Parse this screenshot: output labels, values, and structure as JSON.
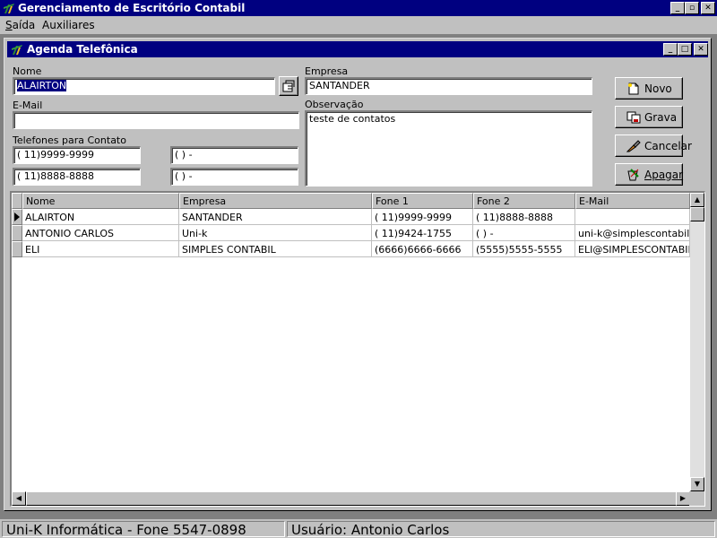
{
  "app": {
    "title": "Gerenciamento de Escritório Contabil",
    "controls": {
      "minimize": "_",
      "restore": "▫",
      "close": "✕"
    }
  },
  "menu": [
    {
      "label": "Saída"
    },
    {
      "label": "Auxiliares"
    }
  ],
  "child": {
    "title": "Agenda Telefônica"
  },
  "form": {
    "nome_label": "Nome",
    "nome_value": "ALAIRTON",
    "empresa_label": "Empresa",
    "empresa_value": "SANTANDER",
    "email_label": "E-Mail",
    "email_value": "",
    "observacao_label": "Observação",
    "observacao_value": "teste de contatos",
    "telefones_label": "Telefones para Contato",
    "phone1": "( 11)9999-9999",
    "phone2": "(    )      -",
    "phone3": "( 11)8888-8888",
    "phone4": "(    )      -"
  },
  "buttons": {
    "novo": "Novo",
    "grava": "Grava",
    "cancelar": "Cancelar",
    "apagar": "Apagar"
  },
  "grid": {
    "columns": [
      "Nome",
      "Empresa",
      "Fone 1",
      "Fone 2",
      "E-Mail"
    ],
    "rows": [
      [
        "ALAIRTON",
        "SANTANDER",
        "( 11)9999-9999",
        "( 11)8888-8888",
        ""
      ],
      [
        "ANTONIO CARLOS",
        "Uni-k",
        "( 11)9424-1755",
        "(    )      -",
        "uni-k@simplescontabil.com"
      ],
      [
        "ELI",
        "SIMPLES CONTABIL",
        "(6666)6666-6666",
        "(5555)5555-5555",
        "ELI@SIMPLESCONTABIL"
      ]
    ]
  },
  "status": {
    "company": "Uni-K Informática - Fone 5547-0898",
    "user": "Usuário: Antonio Carlos"
  },
  "colors": {
    "titlebar": "#000080",
    "face": "#c0c0c0",
    "selection": "#000080"
  }
}
